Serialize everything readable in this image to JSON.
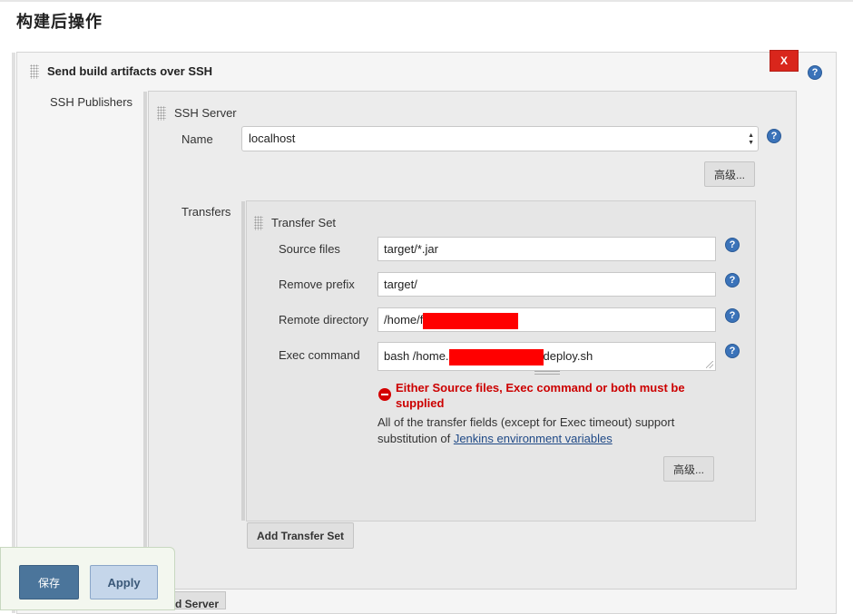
{
  "page": {
    "section_title": "构建后操作"
  },
  "plugin": {
    "title": "Send build artifacts over SSH",
    "delete_label": "X",
    "publishers_label": "SSH Publishers"
  },
  "ssh_server": {
    "title": "SSH Server",
    "name_label": "Name",
    "name_value": "localhost",
    "advanced_label": "高级...",
    "transfers_label": "Transfers"
  },
  "transfer_set": {
    "title": "Transfer Set",
    "source_files_label": "Source files",
    "source_files_value": "target/*.jar",
    "remove_prefix_label": "Remove prefix",
    "remove_prefix_value": "target/",
    "remote_directory_label": "Remote directory",
    "remote_directory_value": "/home/f",
    "exec_command_label": "Exec command",
    "exec_command_prefix": "bash /home.",
    "exec_command_suffix": "deploy.sh",
    "error_message": "Either Source files, Exec command or both must be supplied",
    "info_prefix": "All of the transfer fields (except for Exec timeout) support substitution of ",
    "info_link": "Jenkins environment variables",
    "advanced_label": "高级...",
    "add_transfer_label": "Add Transfer Set"
  },
  "footer": {
    "save_label": "保存",
    "apply_label": "Apply",
    "add_server_label": "Add Server"
  },
  "help_symbol": "?",
  "colors": {
    "delete": "#d9261c",
    "help": "#3b73b9",
    "error": "#cc0000",
    "save": "#4b759b",
    "apply": "#c5d6ea",
    "redaction": "#ff0000",
    "link": "#204a87"
  }
}
